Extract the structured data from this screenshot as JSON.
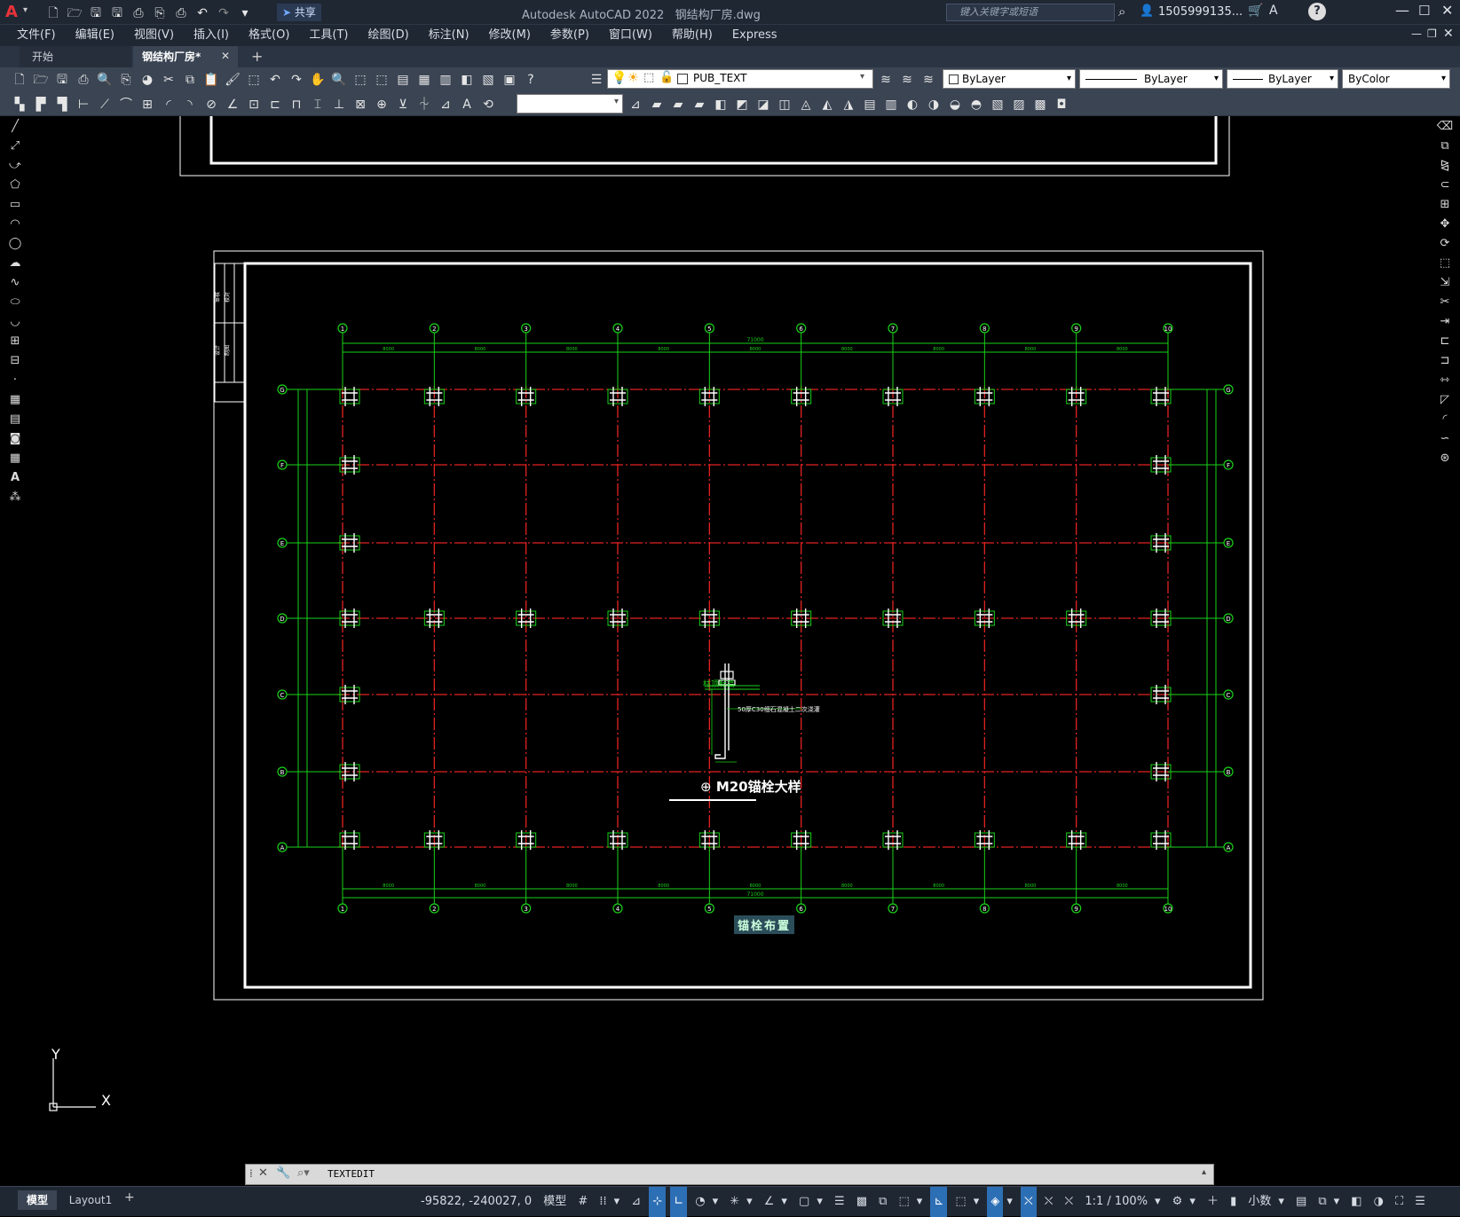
{
  "title": {
    "app": "Autodesk AutoCAD 2022",
    "file": "钢结构厂房.dwg",
    "search_placeholder": "键入关键字或短语",
    "user": "1505999135...",
    "share": "共享"
  },
  "menu": [
    "文件(F)",
    "编辑(E)",
    "视图(V)",
    "插入(I)",
    "格式(O)",
    "工具(T)",
    "绘图(D)",
    "标注(N)",
    "修改(M)",
    "参数(P)",
    "窗口(W)",
    "帮助(H)",
    "Express"
  ],
  "tabs": {
    "start": "开始",
    "doc": "钢结构厂房*",
    "plus": "+"
  },
  "layer": {
    "name": "PUB_TEXT",
    "color": "ByLayer",
    "linetype": "ByLayer",
    "lineweight": "ByLayer",
    "plot": "ByColor"
  },
  "drawing": {
    "grid_cols": [
      "1",
      "2",
      "3",
      "4",
      "5",
      "6",
      "7",
      "8",
      "9",
      "10"
    ],
    "grid_rows": [
      "G",
      "F",
      "E",
      "D",
      "C",
      "B",
      "A"
    ],
    "total_dim": "71000",
    "bay_dim": "8000",
    "detail_title": "M20锚栓大样",
    "detail_note1": "柱顶标高",
    "detail_note2": "50厚C30细石混凝土二次浇灌",
    "plan_title": "锚栓布置",
    "titleblock": [
      "审核",
      "校对",
      "设计",
      "制图"
    ]
  },
  "ucs": {
    "x": "X",
    "y": "Y"
  },
  "cmd": {
    "text": "TEXTEDIT"
  },
  "layout_tabs": {
    "model": "模型",
    "layout1": "Layout1",
    "add": "+"
  },
  "status": {
    "coords": "-95822, -240027, 0",
    "space": "模型",
    "scale": "1:1 / 100%",
    "units": "小数"
  },
  "colors": {
    "grid_red": "#e32222",
    "dim_green": "#19d219",
    "frame_white": "#ffffff"
  }
}
